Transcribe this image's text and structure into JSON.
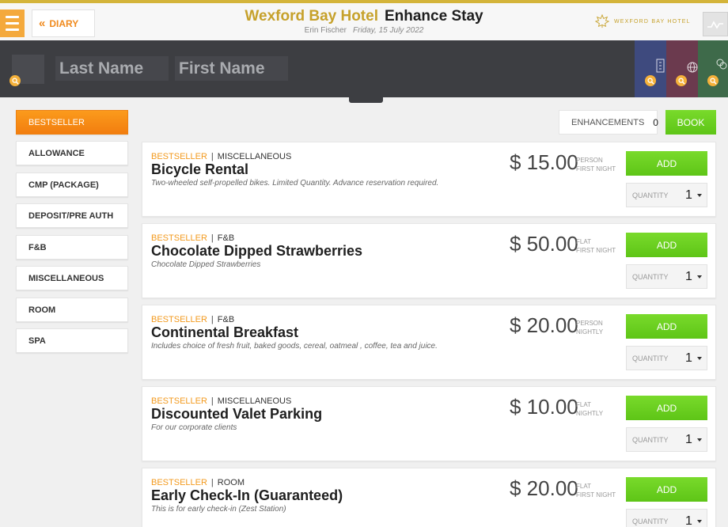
{
  "header": {
    "diary_label": "DIARY",
    "hotel_name": "Wexford Bay Hotel",
    "page_title": "Enhance Stay",
    "guest_user": "Erin Fischer",
    "date": "Friday, 15 July 2022",
    "logo_text": "WEXFORD BAY HOTEL",
    "accent_color": "#c6a12b"
  },
  "guest": {
    "last_name_placeholder": "Last Name",
    "first_name_placeholder": "First Name"
  },
  "sidebar": {
    "items": [
      {
        "label": "BESTSELLER",
        "active": true
      },
      {
        "label": "ALLOWANCE",
        "active": false
      },
      {
        "label": "CMP (PACKAGE)",
        "active": false
      },
      {
        "label": "DEPOSIT/PRE AUTH",
        "active": false
      },
      {
        "label": "F&B",
        "active": false
      },
      {
        "label": "MISCELLANEOUS",
        "active": false
      },
      {
        "label": "ROOM",
        "active": false
      },
      {
        "label": "SPA",
        "active": false
      }
    ]
  },
  "actions": {
    "enhancements_label": "ENHANCEMENTS",
    "enhancements_count": "0",
    "book_label": "BOOK"
  },
  "items": [
    {
      "tag": "BESTSELLER",
      "category": "MISCELLANEOUS",
      "name": "Bicycle Rental",
      "description": "Two-wheeled self-propelled bikes. Limited Quantity. Advance reservation required.",
      "price": "$ 15.00",
      "unit_1": "PERSON",
      "unit_2": "FIRST NIGHT",
      "add_label": "ADD",
      "quantity_label": "QUANTITY",
      "quantity": "1"
    },
    {
      "tag": "BESTSELLER",
      "category": "F&B",
      "name": "Chocolate Dipped Strawberries",
      "description": "Chocolate Dipped Strawberries",
      "price": "$ 50.00",
      "unit_1": "FLAT",
      "unit_2": "FIRST NIGHT",
      "add_label": "ADD",
      "quantity_label": "QUANTITY",
      "quantity": "1"
    },
    {
      "tag": "BESTSELLER",
      "category": "F&B",
      "name": "Continental Breakfast",
      "description": "Includes choice of fresh fruit, baked goods, cereal, oatmeal , coffee, tea and juice.",
      "price": "$ 20.00",
      "unit_1": "PERSON",
      "unit_2": "NIGHTLY",
      "add_label": "ADD",
      "quantity_label": "QUANTITY",
      "quantity": "1"
    },
    {
      "tag": "BESTSELLER",
      "category": "MISCELLANEOUS",
      "name": "Discounted Valet Parking",
      "description": "For our corporate clients",
      "price": "$ 10.00",
      "unit_1": "FLAT",
      "unit_2": "NIGHTLY",
      "add_label": "ADD",
      "quantity_label": "QUANTITY",
      "quantity": "1"
    },
    {
      "tag": "BESTSELLER",
      "category": "ROOM",
      "name": "Early Check-In (Guaranteed)",
      "description": "This is for early check-in (Zest Station)",
      "price": "$ 20.00",
      "unit_1": "FLAT",
      "unit_2": "FIRST NIGHT",
      "add_label": "ADD",
      "quantity_label": "QUANTITY",
      "quantity": "1"
    }
  ]
}
